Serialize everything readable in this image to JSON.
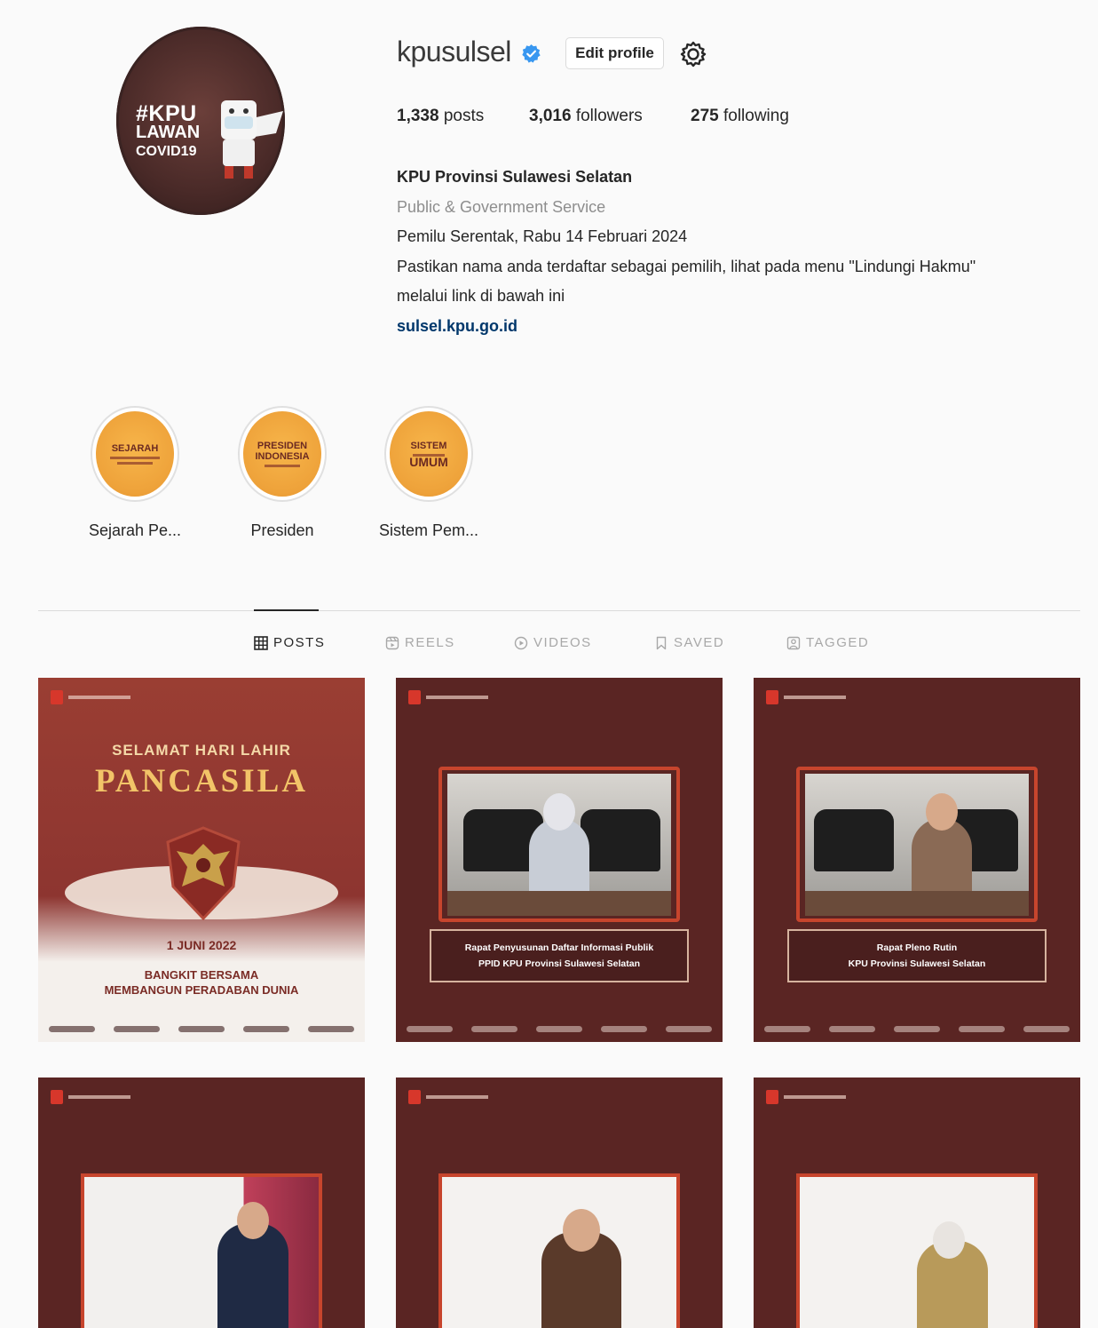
{
  "profile": {
    "username": "kpusulsel",
    "edit_label": "Edit profile",
    "avatar_text": [
      "#KPU",
      "LAWAN",
      "COVID19"
    ],
    "stats": {
      "posts": "1,338",
      "posts_label": "posts",
      "followers": "3,016",
      "followers_label": "followers",
      "following": "275",
      "following_label": "following"
    },
    "bio": {
      "name": "KPU Provinsi Sulawesi Selatan",
      "category": "Public & Government Service",
      "line1": "Pemilu Serentak, Rabu 14 Februari 2024",
      "line2": "Pastikan nama anda terdaftar sebagai pemilih, lihat pada menu \"Lindungi Hakmu\"",
      "line3": "melalui link di bawah ini",
      "link": "sulsel.kpu.go.id"
    }
  },
  "highlights": [
    {
      "label": "Sejarah Pe...",
      "cover_line1": "SEJARAH",
      "cover_line2": ""
    },
    {
      "label": "Presiden",
      "cover_line1": "PRESIDEN",
      "cover_line2": "INDONESIA"
    },
    {
      "label": "Sistem Pem...",
      "cover_line1": "SISTEM",
      "cover_line2": "UMUM"
    }
  ],
  "tabs": [
    {
      "label": "POSTS",
      "icon": "grid-icon",
      "active": true
    },
    {
      "label": "REELS",
      "icon": "reels-icon",
      "active": false
    },
    {
      "label": "VIDEOS",
      "icon": "video-icon",
      "active": false
    },
    {
      "label": "SAVED",
      "icon": "bookmark-icon",
      "active": false
    },
    {
      "label": "TAGGED",
      "icon": "tag-icon",
      "active": false
    }
  ],
  "posts": {
    "p1": {
      "title1": "SELAMAT HARI LAHIR",
      "title2": "PANCASILA",
      "date": "1 JUNI 2022",
      "sub1": "BANGKIT BERSAMA",
      "sub2": "MEMBANGUN PERADABAN DUNIA"
    },
    "p2": {
      "caption1": "Rapat Penyusunan Daftar Informasi Publik",
      "caption2": "PPID KPU Provinsi Sulawesi Selatan"
    },
    "p3": {
      "caption1": "Rapat Pleno Rutin",
      "caption2": "KPU Provinsi Sulawesi Selatan"
    }
  },
  "colors": {
    "verified": "#3897f0",
    "link": "#00376b",
    "post_bg": "#5a2523",
    "accent_frame": "#c7452d",
    "highlight": "#eea23a"
  }
}
